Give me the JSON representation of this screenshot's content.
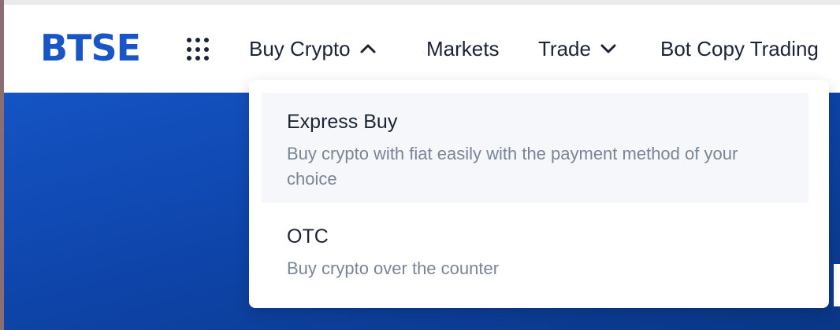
{
  "brand": {
    "logo_text": "BTSE",
    "color": "#1a55c7"
  },
  "nav": {
    "apps_icon": "grid-dots-icon",
    "items": [
      {
        "label": "Buy Crypto",
        "icon": "chevron-up-icon",
        "expanded": true
      },
      {
        "label": "Markets"
      },
      {
        "label": "Trade",
        "icon": "chevron-down-icon"
      },
      {
        "label": "Bot Copy Trading"
      }
    ]
  },
  "dropdown": {
    "items": [
      {
        "title": "Express Buy",
        "description": "Buy crypto with fiat easily with the payment method of your choice",
        "highlighted": true
      },
      {
        "title": "OTC",
        "description": "Buy crypto over the counter"
      }
    ]
  }
}
